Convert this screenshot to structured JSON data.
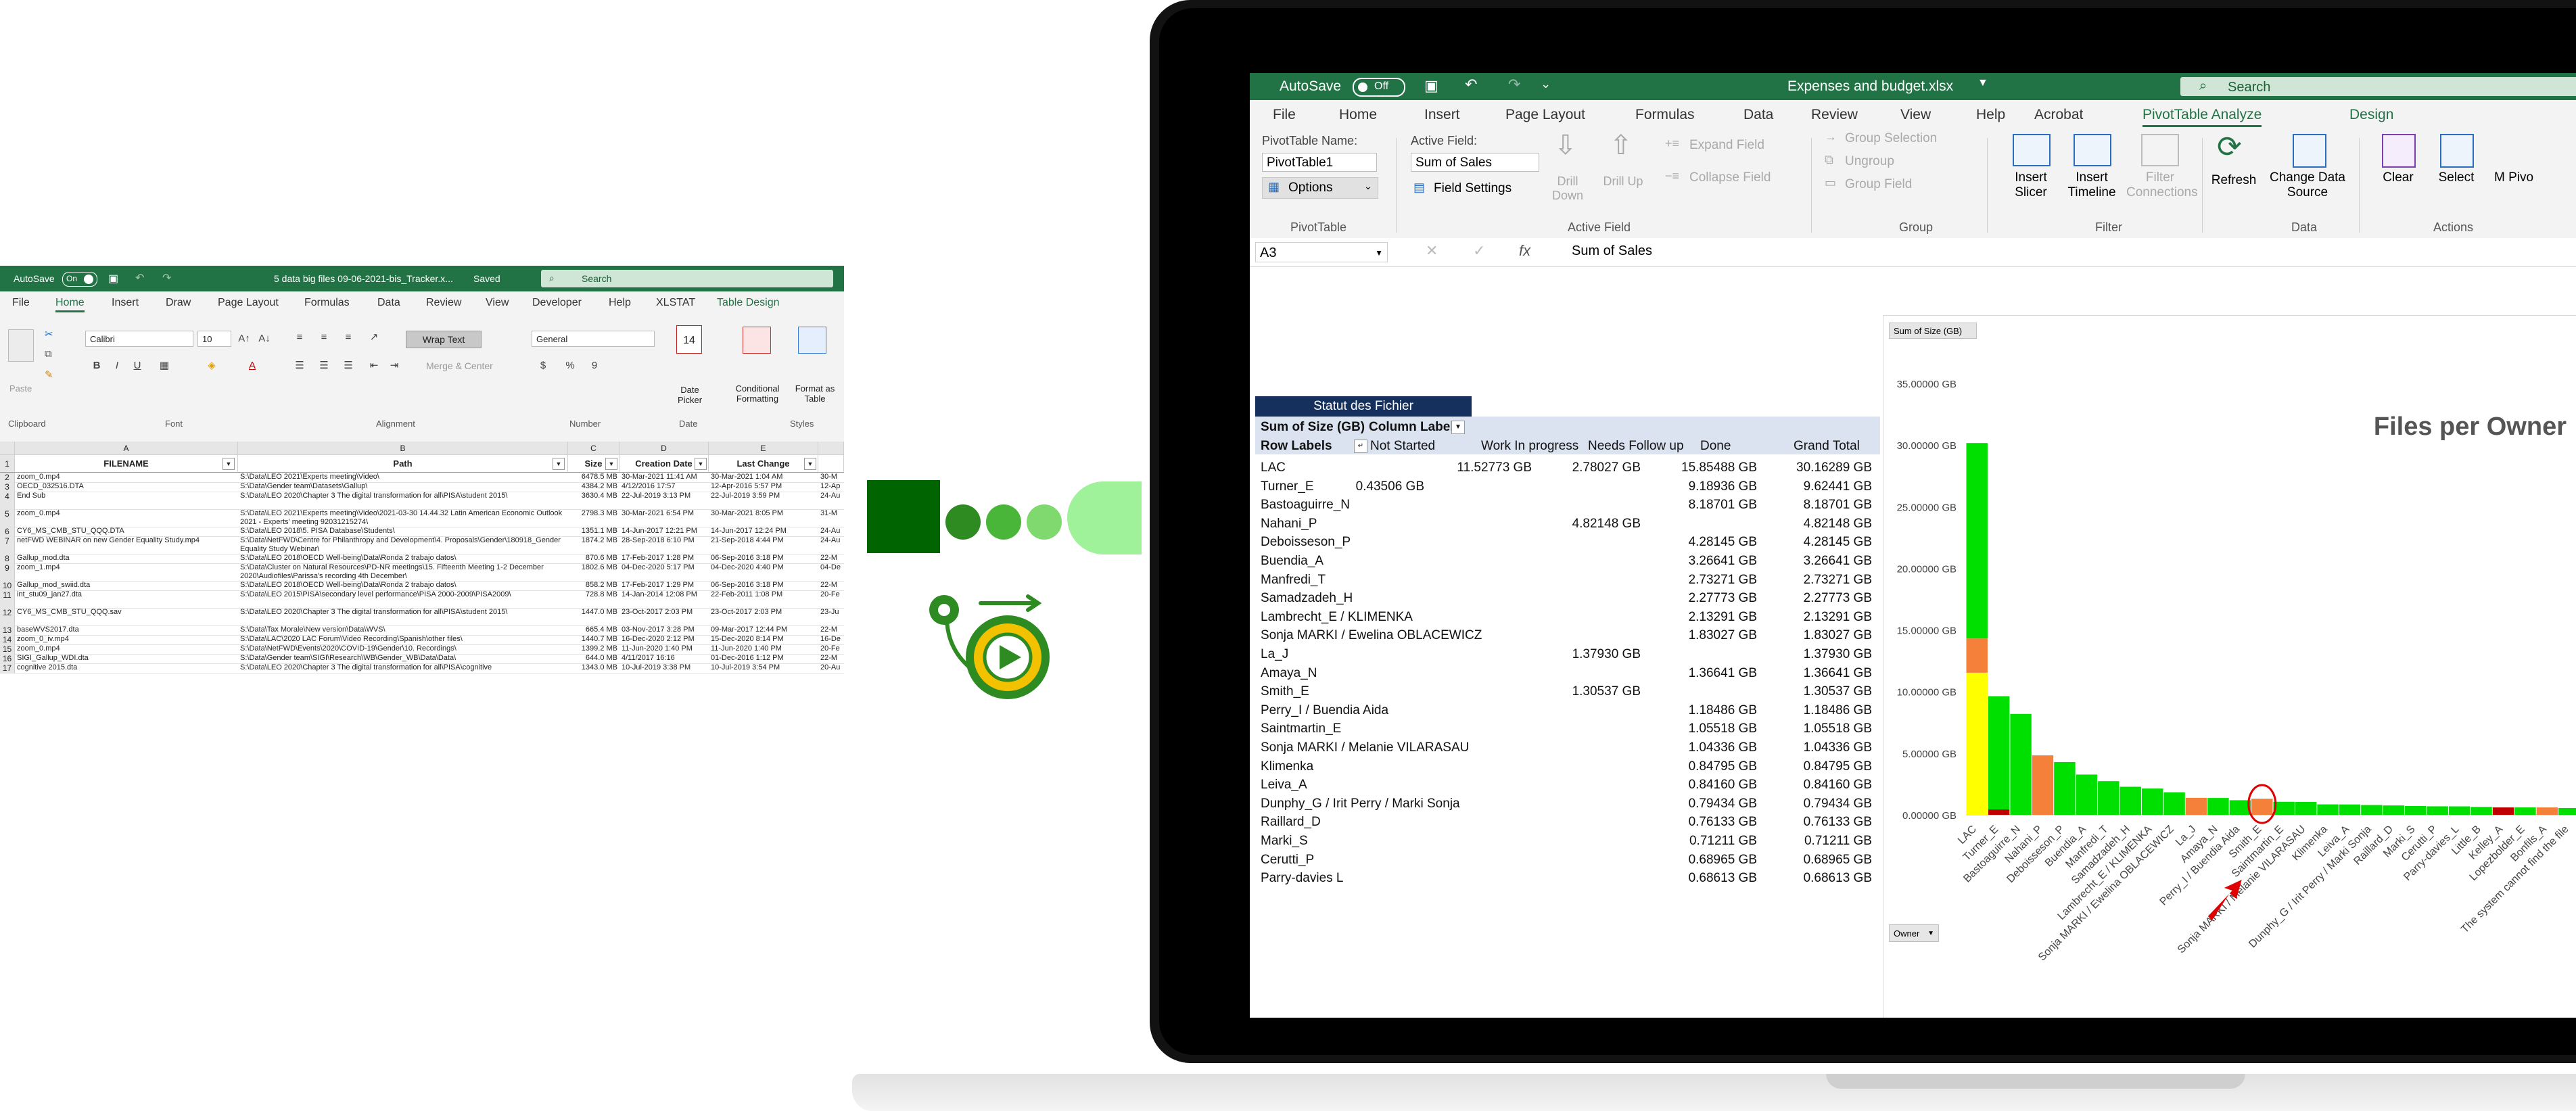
{
  "left_window": {
    "title_bar": {
      "autosave_label": "AutoSave",
      "autosave_state": "On",
      "filename": "5 data big files 09-06-2021-bis_Tracker.x...",
      "saved_status": "Saved",
      "search_placeholder": "Search"
    },
    "tabs": [
      "File",
      "Home",
      "Insert",
      "Draw",
      "Page Layout",
      "Formulas",
      "Data",
      "Review",
      "View",
      "Developer",
      "Help",
      "XLSTAT",
      "Table Design"
    ],
    "active_tab": "Home",
    "ribbon": {
      "paste_label": "Paste",
      "font_name": "Calibri",
      "font_size": "10",
      "wrap_text_label": "Wrap Text",
      "merge_center_label": "Merge & Center",
      "number_format": "General",
      "date_picker_day": "14",
      "date_picker_label": "Date Picker",
      "conditional_formatting_label": "Conditional Formatting",
      "format_as_table_label": "Format as Table",
      "groups": [
        "Clipboard",
        "Font",
        "Alignment",
        "Number",
        "Date",
        "Styles"
      ]
    },
    "grid": {
      "column_letters": [
        "A",
        "B",
        "C",
        "D",
        "E"
      ],
      "headers": [
        "FILENAME",
        "Path",
        "Size",
        "Creation Date",
        "Last Change"
      ],
      "rows": [
        {
          "n": "2",
          "cells": [
            "zoom_0.mp4",
            "S:\\Data\\LEO 2021\\Experts meeting\\Video\\",
            "6478.5 MB",
            "30-Mar-2021 11:41 AM",
            "30-Mar-2021 1:04 AM",
            "30-M"
          ]
        },
        {
          "n": "3",
          "cells": [
            "OECD_032516.DTA",
            "S:\\Data\\Gender team\\Datasets\\Gallup\\",
            "4384.2 MB",
            "4/12/2016 17:57",
            "12-Apr-2016 5:57 PM",
            "12-Ap"
          ]
        },
        {
          "n": "4",
          "cells": [
            "End Sub",
            "S:\\Data\\LEO 2020\\Chapter 3 The digital transformation for all\\PISA\\student 2015\\",
            "3630.4 MB",
            "22-Jul-2019 3:13 PM",
            "22-Jul-2019 3:59 PM",
            "24-Au"
          ]
        },
        {
          "n": "5",
          "cells": [
            "zoom_0.mp4",
            "S:\\Data\\LEO 2021\\Experts meeting\\Video\\2021-03-30 14.44.32 Latin American Economic Outlook 2021 - Experts' meeting 92031215274\\",
            "2798.3 MB",
            "30-Mar-2021 6:54 PM",
            "30-Mar-2021 8:05 PM",
            "31-M"
          ]
        },
        {
          "n": "6",
          "cells": [
            "CY6_MS_CMB_STU_QQQ.DTA",
            "S:\\Data\\LEO 2018\\5. PISA Database\\Students\\",
            "1351.1 MB",
            "14-Jun-2017 12:21 PM",
            "14-Jun-2017 12:24 PM",
            "24-Au"
          ]
        },
        {
          "n": "7",
          "cells": [
            "netFWD WEBINAR on new Gender Equality Study.mp4",
            "S:\\Data\\NetFWD\\Centre for Philanthropy and Development\\4. Proposals\\Gender\\180918_Gender Equality Study Webinar\\",
            "1874.2 MB",
            "28-Sep-2018 6:10 PM",
            "21-Sep-2018 4:44 PM",
            "24-Au"
          ]
        },
        {
          "n": "8",
          "cells": [
            "Gallup_mod.dta",
            "S:\\Data\\LEO 2018\\OECD Well-being\\Data\\Ronda 2 trabajo datos\\",
            "870.6 MB",
            "17-Feb-2017 1:28 PM",
            "06-Sep-2016 3:18 PM",
            "22-M"
          ]
        },
        {
          "n": "9",
          "cells": [
            "zoom_1.mp4",
            "S:\\Data\\Cluster on Natural Resources\\PD-NR meetings\\15. Fifteenth Meeting 1-2 December 2020\\Audiofiles\\Parissa's recording 4th December\\",
            "1802.6 MB",
            "04-Dec-2020 5:17 PM",
            "04-Dec-2020 4:40 PM",
            "04-De"
          ]
        },
        {
          "n": "10",
          "cells": [
            "Gallup_mod_swiid.dta",
            "S:\\Data\\LEO 2018\\OECD Well-being\\Data\\Ronda 2 trabajo datos\\",
            "858.2 MB",
            "17-Feb-2017 1:29 PM",
            "06-Sep-2016 3:18 PM",
            "22-M"
          ]
        },
        {
          "n": "11",
          "cells": [
            "int_stu09_jan27.dta",
            "S:\\Data\\LEO 2015\\PISA\\secondary level performance\\PISA 2000-2009\\PISA2009\\",
            "728.8 MB",
            "14-Jan-2014 12:08 PM",
            "22-Feb-2011 1:08 PM",
            "20-Fe"
          ]
        },
        {
          "n": "12",
          "cells": [
            "CY6_MS_CMB_STU_QQQ.sav",
            "S:\\Data\\LEO 2020\\Chapter 3 The digital transformation for all\\PISA\\student 2015\\",
            "1447.0 MB",
            "23-Oct-2017 2:03 PM",
            "23-Oct-2017 2:03 PM",
            "23-Ju"
          ]
        },
        {
          "n": "13",
          "cells": [
            "baseWVS2017.dta",
            "S:\\Data\\Tax Morale\\New version\\Data\\WVS\\",
            "665.4 MB",
            "03-Nov-2017 3:28 PM",
            "09-Mar-2017 12:44 PM",
            "22-M"
          ]
        },
        {
          "n": "14",
          "cells": [
            "zoom_0_iv.mp4",
            "S:\\Data\\LAC\\2020 LAC Forum\\Video Recording\\Spanish\\other files\\",
            "1440.7 MB",
            "16-Dec-2020 2:12 PM",
            "15-Dec-2020 8:14 PM",
            "16-De"
          ]
        },
        {
          "n": "15",
          "cells": [
            "zoom_0.mp4",
            "S:\\Data\\NetFWD\\Events\\2020\\COVID-19\\Gender\\10. Recordings\\",
            "1399.2 MB",
            "11-Jun-2020 1:40 PM",
            "11-Jun-2020 1:40 PM",
            "20-Fe"
          ]
        },
        {
          "n": "16",
          "cells": [
            "SIGI_Gallup_WDI.dta",
            "S:\\Data\\Gender team\\SIGI\\Research\\WB\\Gender_WB\\Data\\Data\\",
            "644.0 MB",
            "4/11/2017 16:16",
            "01-Dec-2016 1:12 PM",
            "22-M"
          ]
        },
        {
          "n": "17",
          "cells": [
            "cognitive 2015.dta",
            "S:\\Data\\LEO 2020\\Chapter 3 The digital transformation for all\\PISA\\cognitive",
            "1343.0 MB",
            "10-Jul-2019 3:38 PM",
            "10-Jul-2019 3:54 PM",
            "20-Au"
          ]
        }
      ]
    }
  },
  "icons": {
    "colors": [
      "#006400",
      "#2e8b22",
      "#49b63a",
      "#7fd96e",
      "#9ff29a"
    ]
  },
  "laptop_window": {
    "title_bar": {
      "autosave_label": "AutoSave",
      "autosave_state": "Off",
      "filename": "Expenses and budget.xlsx",
      "search_placeholder": "Search"
    },
    "tabs": [
      "File",
      "Home",
      "Insert",
      "Page Layout",
      "Formulas",
      "Data",
      "Review",
      "View",
      "Help",
      "Acrobat",
      "PivotTable Analyze",
      "Design"
    ],
    "active_tab": "PivotTable Analyze",
    "ribbon": {
      "pivottable_name_label": "PivotTable Name:",
      "pivottable_name_value": "PivotTable1",
      "options_label": "Options",
      "pivottable_group": "PivotTable",
      "active_field_label": "Active Field:",
      "active_field_value": "Sum of Sales",
      "field_settings_label": "Field Settings",
      "drill_down_label": "Drill Down",
      "drill_up_label": "Drill Up",
      "expand_field_label": "Expand Field",
      "collapse_field_label": "Collapse Field",
      "active_field_group": "Active Field",
      "group_selection_label": "Group Selection",
      "ungroup_label": "Ungroup",
      "group_field_label": "Group Field",
      "group_group": "Group",
      "insert_slicer_label": "Insert Slicer",
      "insert_timeline_label": "Insert Timeline",
      "filter_connections_label": "Filter Connections",
      "filter_group": "Filter",
      "refresh_label": "Refresh",
      "change_data_source_label": "Change Data Source",
      "data_group": "Data",
      "clear_label": "Clear",
      "select_label": "Select",
      "move_label": "M Pivo",
      "actions_group": "Actions"
    },
    "formula_bar": {
      "name_box": "A3",
      "fx": "fx",
      "formula": "Sum of Sales"
    },
    "pivot": {
      "filter_label": "Statut des Fichier",
      "values_label": "Sum of Size (GB)",
      "column_labels": "Column Labels",
      "row_labels": "Row Labels",
      "columns": [
        "Not Started",
        "Work In progress",
        "Needs Follow up",
        "Done",
        "Grand Total"
      ],
      "rows": [
        {
          "label": "LAC",
          "values": [
            "",
            "11.52773 GB",
            "2.78027 GB",
            "15.85488 GB",
            "30.16289 GB"
          ]
        },
        {
          "label": "Turner_E",
          "values": [
            "0.43506 GB",
            "",
            "",
            "9.18936 GB",
            "9.62441 GB"
          ]
        },
        {
          "label": "Bastoaguirre_N",
          "values": [
            "",
            "",
            "",
            "8.18701 GB",
            "8.18701 GB"
          ]
        },
        {
          "label": "Nahani_P",
          "values": [
            "",
            "",
            "4.82148 GB",
            "",
            "4.82148 GB"
          ]
        },
        {
          "label": "Deboisseson_P",
          "values": [
            "",
            "",
            "",
            "4.28145 GB",
            "4.28145 GB"
          ]
        },
        {
          "label": "Buendia_A",
          "values": [
            "",
            "",
            "",
            "3.26641 GB",
            "3.26641 GB"
          ]
        },
        {
          "label": "Manfredi_T",
          "values": [
            "",
            "",
            "",
            "2.73271 GB",
            "2.73271 GB"
          ]
        },
        {
          "label": "Samadzadeh_H",
          "values": [
            "",
            "",
            "",
            "2.27773 GB",
            "2.27773 GB"
          ]
        },
        {
          "label": "Lambrecht_E / KLIMENKA",
          "values": [
            "",
            "",
            "",
            "2.13291 GB",
            "2.13291 GB"
          ]
        },
        {
          "label": "Sonja MARKI / Ewelina OBLACEWICZ",
          "values": [
            "",
            "",
            "",
            "1.83027 GB",
            "1.83027 GB"
          ]
        },
        {
          "label": "La_J",
          "values": [
            "",
            "",
            "1.37930 GB",
            "",
            "1.37930 GB"
          ]
        },
        {
          "label": "Amaya_N",
          "values": [
            "",
            "",
            "",
            "1.36641 GB",
            "1.36641 GB"
          ]
        },
        {
          "label": "Smith_E",
          "values": [
            "",
            "",
            "1.30537 GB",
            "",
            "1.30537 GB"
          ]
        },
        {
          "label": "Perry_I / Buendia Aida",
          "values": [
            "",
            "",
            "",
            "1.18486 GB",
            "1.18486 GB"
          ]
        },
        {
          "label": "Saintmartin_E",
          "values": [
            "",
            "",
            "",
            "1.05518 GB",
            "1.05518 GB"
          ]
        },
        {
          "label": "Sonja MARKI / Melanie VILARASAU",
          "values": [
            "",
            "",
            "",
            "1.04336 GB",
            "1.04336 GB"
          ]
        },
        {
          "label": "Klimenka",
          "values": [
            "",
            "",
            "",
            "0.84795 GB",
            "0.84795 GB"
          ]
        },
        {
          "label": "Leiva_A",
          "values": [
            "",
            "",
            "",
            "0.84160 GB",
            "0.84160 GB"
          ]
        },
        {
          "label": "Dunphy_G / Irit Perry / Marki Sonja",
          "values": [
            "",
            "",
            "",
            "0.79434 GB",
            "0.79434 GB"
          ]
        },
        {
          "label": "Raillard_D",
          "values": [
            "",
            "",
            "",
            "0.76133 GB",
            "0.76133 GB"
          ]
        },
        {
          "label": "Marki_S",
          "values": [
            "",
            "",
            "",
            "0.71211 GB",
            "0.71211 GB"
          ]
        },
        {
          "label": "Cerutti_P",
          "values": [
            "",
            "",
            "",
            "0.68965 GB",
            "0.68965 GB"
          ]
        },
        {
          "label": "Parry-davies  L",
          "values": [
            "",
            "",
            "",
            "0.68613 GB",
            "0.68613 GB"
          ]
        }
      ]
    },
    "chart_button_field": "Sum of Size (GB)",
    "chart_button_owner": "Owner"
  },
  "chart_data": {
    "type": "bar",
    "stacked": true,
    "title": "Files per Owner",
    "ylim": [
      0,
      35
    ],
    "yticks": [
      "0.00000 GB",
      "5.00000 GB",
      "10.00000 GB",
      "15.00000 GB",
      "20.00000 GB",
      "25.00000 GB",
      "30.00000 GB",
      "35.00000 GB"
    ],
    "categories": [
      "LAC",
      "Turner_E",
      "Bastoaguirre_N",
      "Nahani_P",
      "Deboisseson_P",
      "Buendia_A",
      "Manfredi_T",
      "Samadzadeh_H",
      "Lambrecht_E / KLIMENKA",
      "Sonja MARKI / Ewelina OBLACEWICZ",
      "La_J",
      "Amaya_N",
      "Perry_I / Buendia Aida",
      "Smith_E",
      "Saintmartin_E",
      "Sonja MARKI / Melanie VILARASAU",
      "Klimenka",
      "Leiva_A",
      "Dunphy_G / Irit Perry / Marki Sonja",
      "Raillard_D",
      "Marki_S",
      "Cerutti_P",
      "Parry-davies_L",
      "Little_B",
      "Kelley_A",
      "Lopezbolder_E",
      "Bonfils_A",
      "The system cannot find the file"
    ],
    "series": [
      {
        "color": "#ffff00",
        "values": [
          11.52773,
          0,
          0,
          0,
          0,
          0,
          0,
          0,
          0,
          0,
          0,
          0,
          0,
          0,
          0,
          0,
          0,
          0,
          0,
          0,
          0,
          0,
          0,
          0,
          0,
          0,
          0,
          0
        ]
      },
      {
        "color": "#f4803a",
        "values": [
          2.78027,
          0,
          0,
          4.82148,
          0,
          0,
          0,
          0,
          0,
          0,
          1.3793,
          0,
          0,
          1.30537,
          0,
          0,
          0,
          0,
          0,
          0,
          0,
          0,
          0,
          0,
          0,
          0,
          0.6,
          0
        ]
      },
      {
        "color": "#c00000",
        "values": [
          0,
          0.43506,
          0,
          0,
          0,
          0,
          0,
          0,
          0,
          0,
          0,
          0,
          0,
          0,
          0,
          0,
          0,
          0,
          0,
          0,
          0,
          0,
          0,
          0,
          0.6,
          0,
          0,
          0
        ]
      },
      {
        "color": "#00e000",
        "values": [
          15.85488,
          9.18936,
          8.18701,
          0,
          4.28145,
          3.26641,
          2.73271,
          2.27773,
          2.13291,
          1.83027,
          0,
          1.36641,
          1.18486,
          0,
          1.05518,
          1.04336,
          0.84795,
          0.8416,
          0.79434,
          0.76133,
          0.71211,
          0.68965,
          0.68613,
          0.64,
          0,
          0.6,
          0,
          0.55
        ]
      }
    ]
  }
}
